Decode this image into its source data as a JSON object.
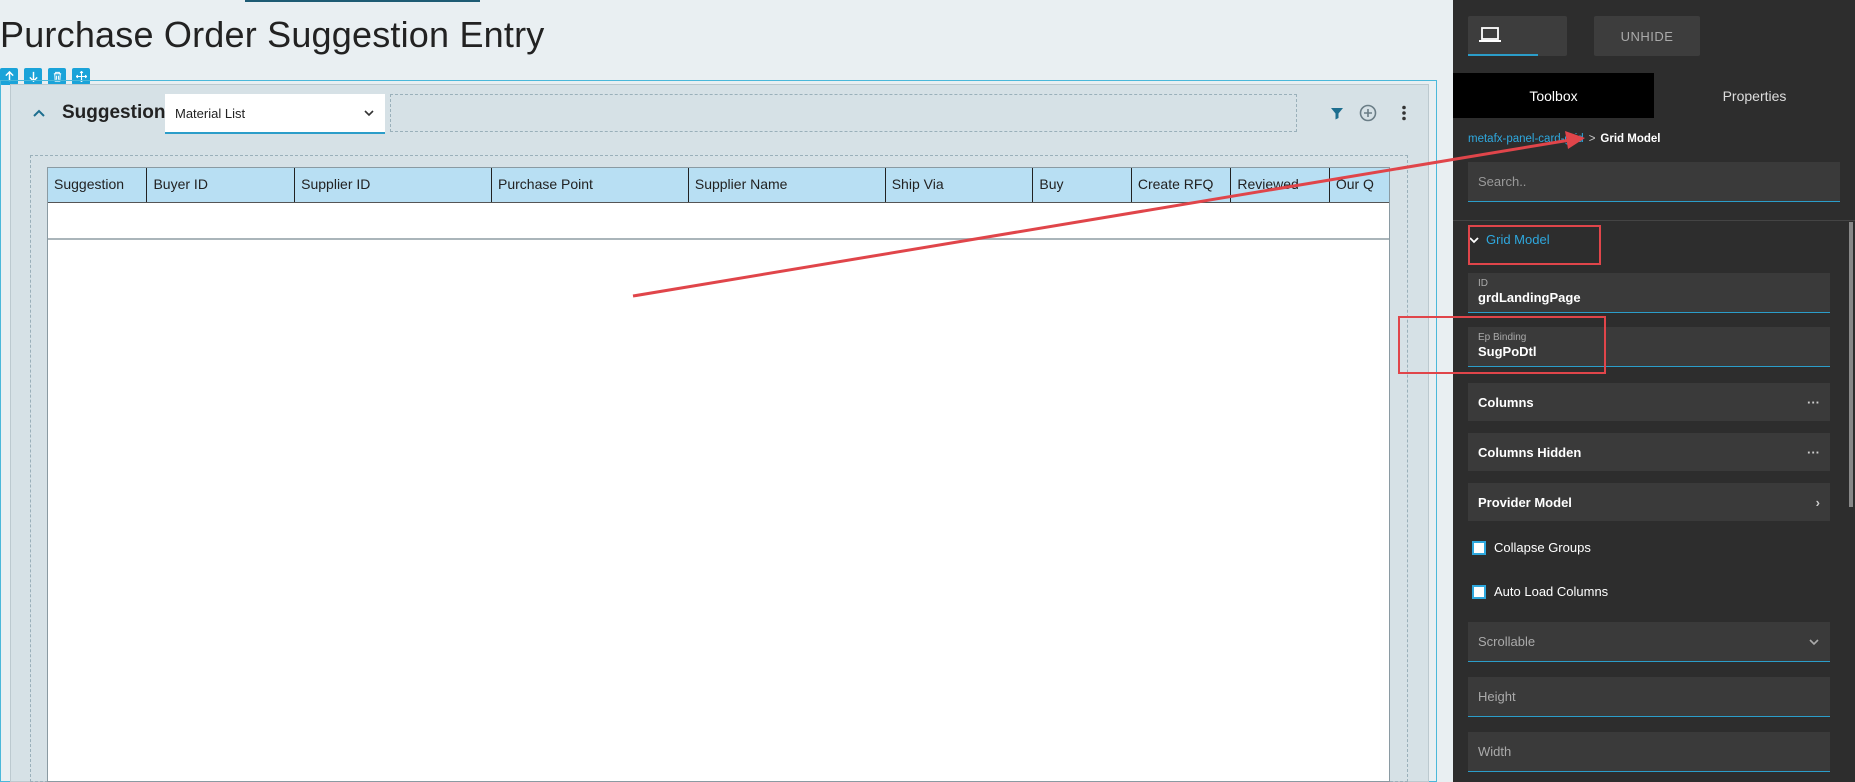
{
  "page": {
    "title": "Purchase Order Suggestion Entry"
  },
  "edit_tools": [
    "arrow-up-icon",
    "arrow-down-icon",
    "trash-icon",
    "move-icon"
  ],
  "panel": {
    "title": "Suggestions",
    "view_select": "Material List",
    "header_icons": [
      "filter-icon",
      "add-circle-icon",
      "more-vertical-icon"
    ]
  },
  "grid": {
    "columns": [
      "Suggestion",
      "Buyer ID",
      "Supplier ID",
      "Purchase Point",
      "Supplier Name",
      "Ship Via",
      "Buy",
      "Create RFQ",
      "Reviewed",
      "Our Q"
    ],
    "rows": []
  },
  "props_panel": {
    "device_icon": "laptop-icon",
    "unhide_label": "UNHIDE",
    "tabs": [
      "Toolbox",
      "Properties"
    ],
    "active_tab": "Toolbox",
    "breadcrumb": {
      "link": "metafx-panel-card-grid",
      "separator": ">",
      "current": "Grid Model"
    },
    "search_placeholder": "Search..",
    "section_title": "Grid Model",
    "id_field": {
      "label": "ID",
      "value": "grdLandingPage"
    },
    "ep_binding_field": {
      "label": "Ep Binding",
      "value": "SugPoDtl"
    },
    "columns_label": "Columns",
    "columns_hidden_label": "Columns Hidden",
    "provider_model_label": "Provider Model",
    "ellipsis": "···",
    "chevron": "›",
    "collapse_groups_label": "Collapse Groups",
    "collapse_groups_checked": false,
    "auto_load_columns_label": "Auto Load Columns",
    "auto_load_columns_checked": false,
    "scrollable_label": "Scrollable",
    "height_label": "Height",
    "width_label": "Width"
  },
  "colors": {
    "accent": "#2b9dc9",
    "grid_header": "#b8dff3",
    "annotation_red": "#e0454a",
    "panel_bg": "#2d2d2d"
  }
}
